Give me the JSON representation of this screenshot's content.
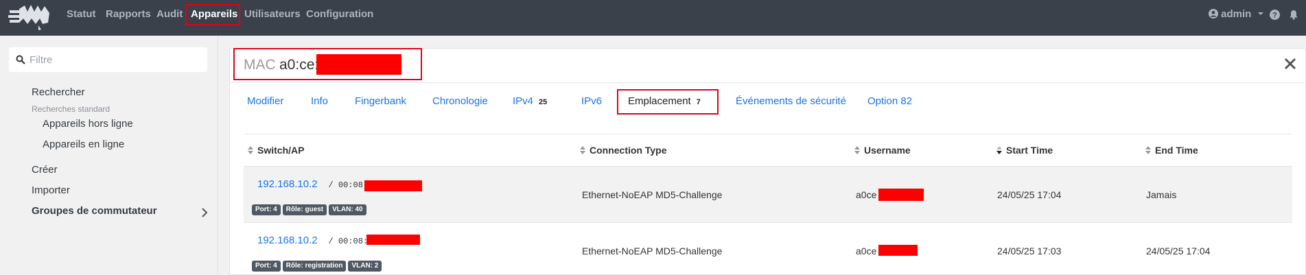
{
  "nav": {
    "items": [
      "Statut",
      "Rapports",
      "Audit",
      "Appareils",
      "Utilisateurs",
      "Configuration"
    ],
    "active": "Appareils",
    "user": "admin"
  },
  "sidebar": {
    "filter_placeholder": "Filtre",
    "search": "Rechercher",
    "standard_header": "Recherches standard",
    "offline": "Appareils hors ligne",
    "online": "Appareils en ligne",
    "create": "Créer",
    "import": "Importer",
    "switch_groups": "Groupes de commutateur"
  },
  "device": {
    "mac_label": "MAC",
    "mac_value": "a0:ce:"
  },
  "tabs": [
    {
      "label": "Modifier"
    },
    {
      "label": "Info"
    },
    {
      "label": "Fingerbank"
    },
    {
      "label": "Chronologie"
    },
    {
      "label": "IPv4",
      "badge": "25"
    },
    {
      "label": "IPv6"
    },
    {
      "label": "Emplacement",
      "badge": "7"
    },
    {
      "label": "Événements de sécurité"
    },
    {
      "label": "Option 82"
    }
  ],
  "active_tab": "Emplacement",
  "table": {
    "columns": [
      "Switch/AP",
      "Connection Type",
      "Username",
      "Start Time",
      "End Time"
    ],
    "sorted_column": "Start Time",
    "rows": [
      {
        "ip": "192.168.10.2",
        "mac_prefix": "/ 00:08:",
        "badges": [
          "Port: 4",
          "Rôle: guest",
          "VLAN: 40"
        ],
        "connection_type": "Ethernet-NoEAP MD5-Challenge",
        "username": "a0ce",
        "start_time": "24/05/25 17:04",
        "end_time": "Jamais"
      },
      {
        "ip": "192.168.10.2",
        "mac_prefix": "/ 00:08:",
        "badges": [
          "Port: 4",
          "Rôle: registration",
          "VLAN: 2"
        ],
        "connection_type": "Ethernet-NoEAP MD5-Challenge",
        "username": "a0ce",
        "start_time": "24/05/25 17:03",
        "end_time": "24/05/25 17:04"
      }
    ]
  },
  "colors": {
    "navbar": "#3a414b",
    "link": "#1a73e8",
    "highlight": "#e0001a",
    "redaction": "#ff0000"
  }
}
